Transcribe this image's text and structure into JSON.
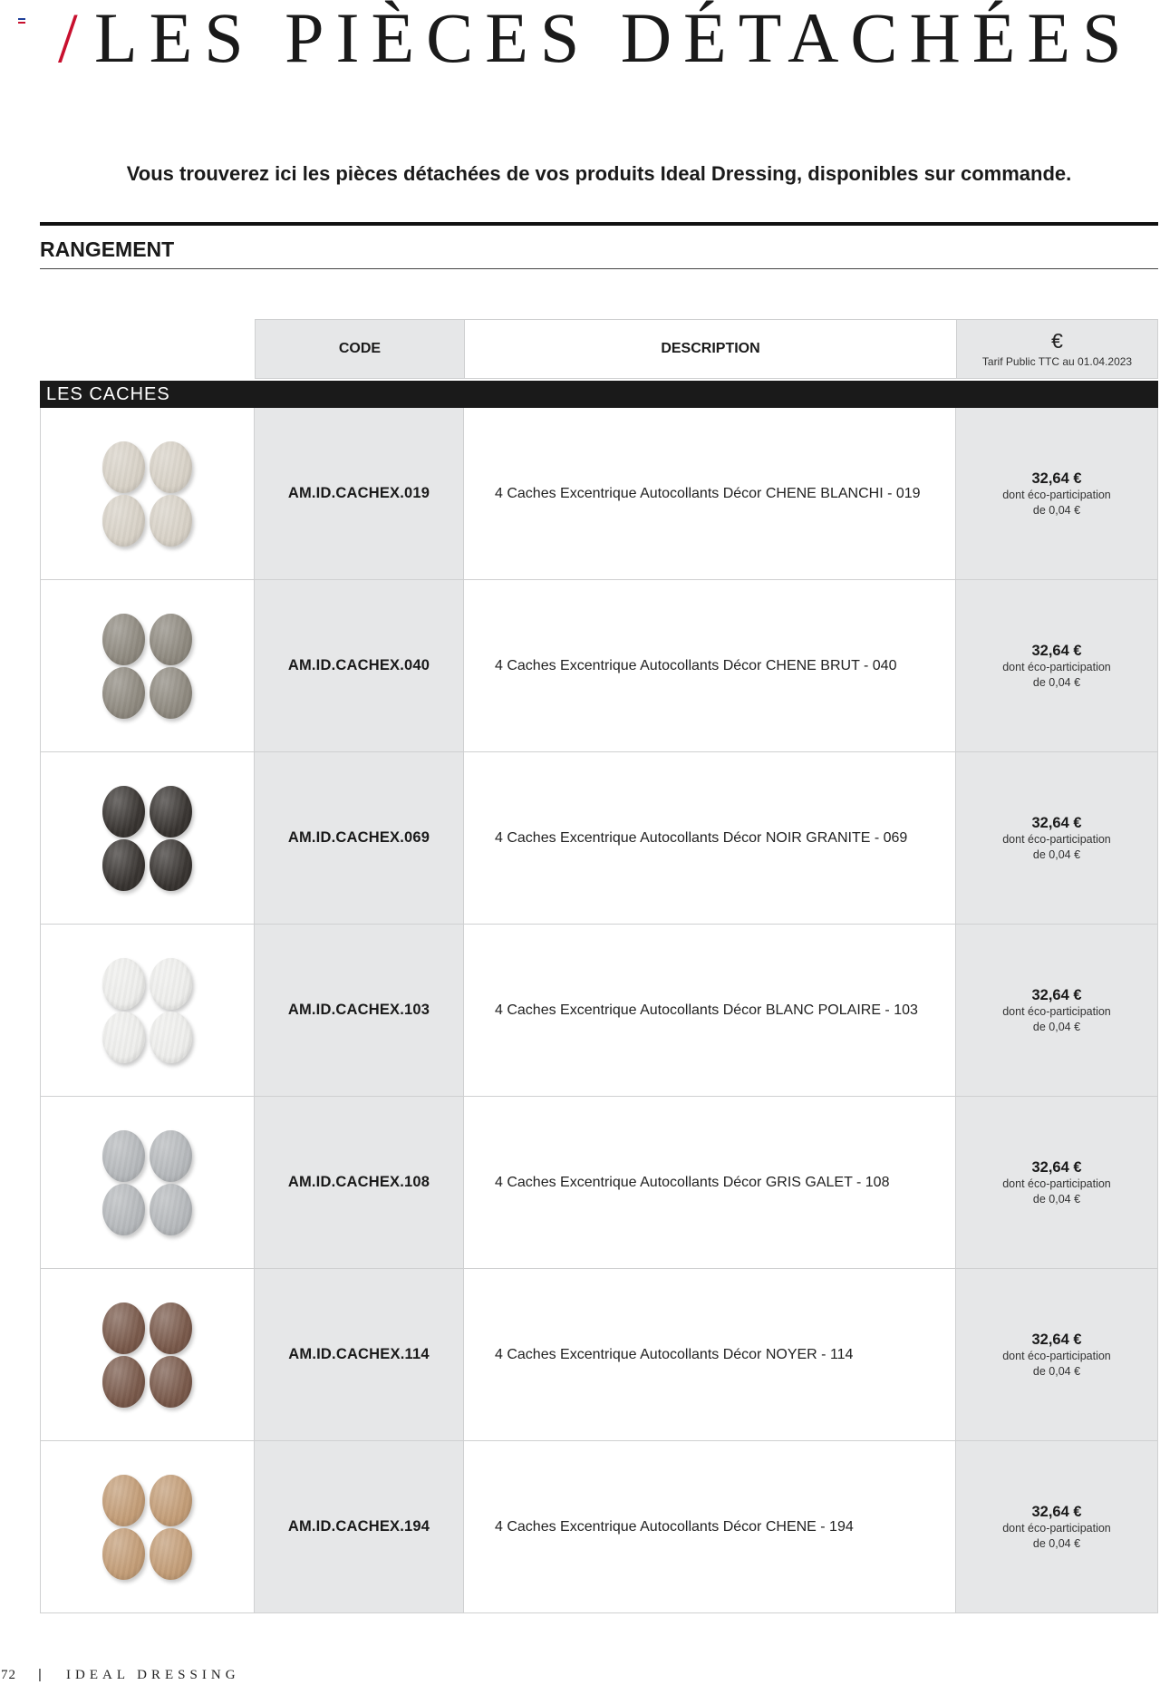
{
  "page": {
    "title_slash": "/",
    "title": "LES PIÈCES DÉTACHÉES",
    "intro": "Vous trouverez ici les pièces détachées de vos produits Ideal Dressing, disponibles sur commande.",
    "section": "RANGEMENT",
    "footer": {
      "page_number": "72",
      "separator": "|",
      "brand": "IDEAL DRESSING"
    }
  },
  "table": {
    "headers": {
      "code": "CODE",
      "description": "DESCRIPTION",
      "price_symbol": "€",
      "price_note": "Tarif Public TTC au 01.04.2023"
    },
    "group": "LES CACHES",
    "rows": [
      {
        "code": "AM.ID.CACHEX.019",
        "description": "4 Caches Excentrique Autocollants Décor CHENE BLANCHI - 019",
        "price": "32,64 €",
        "eco_line1": "dont éco-participation",
        "eco_line2": "de 0,04 €",
        "swatch_color": "#d8d2c7"
      },
      {
        "code": "AM.ID.CACHEX.040",
        "description": "4 Caches Excentrique Autocollants Décor CHENE BRUT - 040",
        "price": "32,64 €",
        "eco_line1": "dont éco-participation",
        "eco_line2": "de 0,04 €",
        "swatch_color": "#8e897f"
      },
      {
        "code": "AM.ID.CACHEX.069",
        "description": "4 Caches Excentrique Autocollants Décor NOIR GRANITE - 069",
        "price": "32,64 €",
        "eco_line1": "dont éco-participation",
        "eco_line2": "de 0,04 €",
        "swatch_color": "#383431"
      },
      {
        "code": "AM.ID.CACHEX.103",
        "description": "4 Caches Excentrique Autocollants Décor BLANC POLAIRE - 103",
        "price": "32,64 €",
        "eco_line1": "dont éco-participation",
        "eco_line2": "de 0,04 €",
        "swatch_color": "#eeeeec"
      },
      {
        "code": "AM.ID.CACHEX.108",
        "description": "4 Caches Excentrique Autocollants Décor GRIS GALET - 108",
        "price": "32,64 €",
        "eco_line1": "dont éco-participation",
        "eco_line2": "de 0,04 €",
        "swatch_color": "#b6b9bc"
      },
      {
        "code": "AM.ID.CACHEX.114",
        "description": "4 Caches Excentrique Autocollants Décor NOYER - 114",
        "price": "32,64 €",
        "eco_line1": "dont éco-participation",
        "eco_line2": "de 0,04 €",
        "swatch_color": "#79594a"
      },
      {
        "code": "AM.ID.CACHEX.194",
        "description": "4 Caches Excentrique Autocollants Décor CHENE - 194",
        "price": "32,64 €",
        "eco_line1": "dont éco-participation",
        "eco_line2": "de 0,04 €",
        "swatch_color": "#c39d77"
      }
    ]
  },
  "colors": {
    "accent": "#c8102e",
    "header_grey": "#e6e7e8",
    "group_bar": "#1a1a1a",
    "flag": [
      "#1f3f99",
      "#ffffff",
      "#c8102e"
    ]
  }
}
